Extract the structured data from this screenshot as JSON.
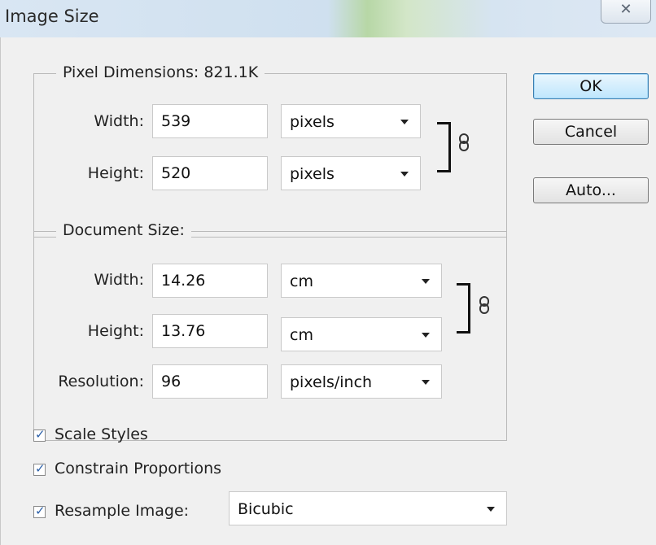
{
  "window": {
    "title": "Image Size",
    "close_glyph": "☒"
  },
  "pixel_dimensions": {
    "legend": "Pixel Dimensions:",
    "size": "821.1K",
    "width_label": "Width:",
    "width_value": "539",
    "width_unit": "pixels",
    "height_label": "Height:",
    "height_value": "520",
    "height_unit": "pixels"
  },
  "document_size": {
    "legend": "Document Size:",
    "width_label": "Width:",
    "width_value": "14.26",
    "width_unit": "cm",
    "height_label": "Height:",
    "height_value": "13.76",
    "height_unit": "cm",
    "resolution_label": "Resolution:",
    "resolution_value": "96",
    "resolution_unit": "pixels/inch"
  },
  "buttons": {
    "ok": "OK",
    "cancel": "Cancel",
    "auto": "Auto..."
  },
  "options": {
    "scale_styles": "Scale Styles",
    "constrain": "Constrain Proportions",
    "resample": "Resample Image:",
    "resample_value": "Bicubic"
  }
}
